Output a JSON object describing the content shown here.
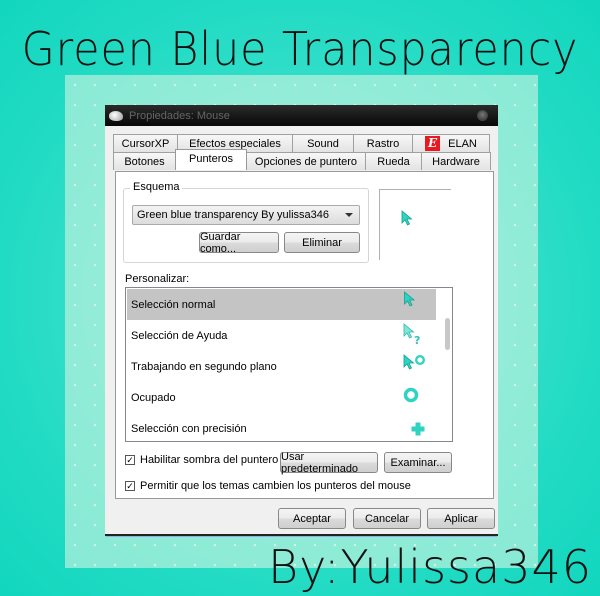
{
  "banner": {
    "title": "Green Blue Transparency",
    "signature": "By:Yulissa346"
  },
  "window": {
    "title": "Propiedades: Mouse",
    "icon": "mouse-icon",
    "tabs_back": [
      "CursorXP",
      "Efectos especiales",
      "Sound",
      "Rastro",
      "ELAN"
    ],
    "tabs_front": [
      "Botones",
      "Punteros",
      "Opciones de puntero",
      "Rueda",
      "Hardware"
    ],
    "active_tab": "Punteros",
    "elan_logo_glyph": "E"
  },
  "scheme": {
    "group_label": "Esquema",
    "selected": "Green blue transparency By yulissa346",
    "save_as_label": "Guardar como...",
    "delete_label": "Eliminar"
  },
  "customize": {
    "label": "Personalizar:",
    "items": [
      {
        "label": "Selección normal",
        "icon": "arrow-cursor-icon",
        "selected": true
      },
      {
        "label": "Selección de Ayuda",
        "icon": "help-cursor-icon",
        "selected": false
      },
      {
        "label": "Trabajando en segundo plano",
        "icon": "working-cursor-icon",
        "selected": false
      },
      {
        "label": "Ocupado",
        "icon": "busy-cursor-icon",
        "selected": false
      },
      {
        "label": "Selección con precisión",
        "icon": "precision-cursor-icon",
        "selected": false
      }
    ]
  },
  "options": {
    "shadow_label": "Habilitar sombra del puntero",
    "shadow_checked": true,
    "themes_label": "Permitir que los temas cambien los punteros del mouse",
    "themes_checked": true,
    "use_default_label": "Usar predeterminado",
    "browse_label": "Examinar..."
  },
  "footer": {
    "ok_label": "Aceptar",
    "cancel_label": "Cancelar",
    "apply_label": "Aplicar"
  },
  "colors": {
    "background": "#22dbc4",
    "cursor_accent": "#2fd3c2",
    "selected_row": "#c4c4c4",
    "elan_red": "#e51a23"
  }
}
